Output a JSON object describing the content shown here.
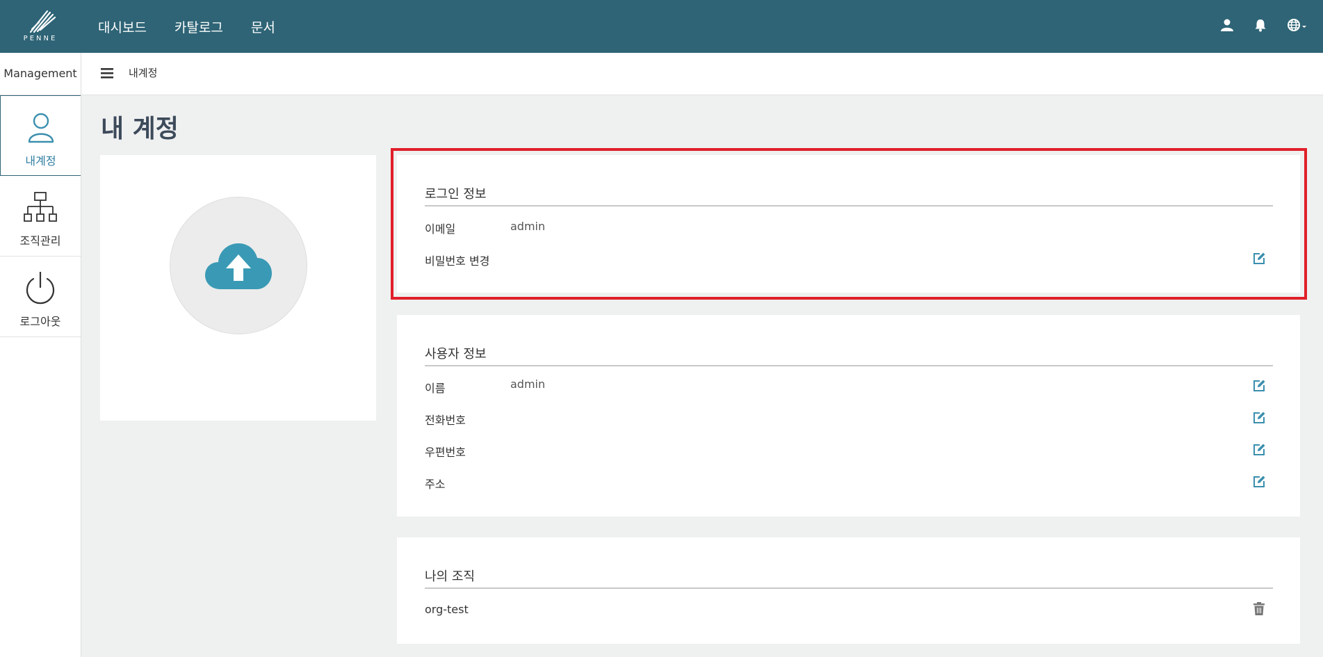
{
  "brand": {
    "logo_text": "PENNE"
  },
  "nav": {
    "items": [
      "대시보드",
      "카탈로그",
      "문서"
    ]
  },
  "header_icons": [
    "user-icon",
    "bell-icon",
    "globe-icon"
  ],
  "sidebar": {
    "header": "Management",
    "items": [
      {
        "label": "내계정",
        "icon": "user-outline-icon",
        "active": true
      },
      {
        "label": "조직관리",
        "icon": "org-chart-icon"
      },
      {
        "label": "로그아웃",
        "icon": "power-icon"
      }
    ]
  },
  "breadcrumb": {
    "current": "내계정"
  },
  "page": {
    "title": "내 계정"
  },
  "avatar": {
    "icon": "cloud-upload-icon"
  },
  "login_info": {
    "title": "로그인 정보",
    "email_label": "이메일",
    "email_value": "admin",
    "password_label": "비밀번호 변경"
  },
  "user_info": {
    "title": "사용자 정보",
    "rows": [
      {
        "label": "이름",
        "value": "admin"
      },
      {
        "label": "전화번호",
        "value": ""
      },
      {
        "label": "우편번호",
        "value": ""
      },
      {
        "label": "주소",
        "value": ""
      }
    ]
  },
  "org": {
    "title": "나의 조직",
    "items": [
      "org-test"
    ]
  },
  "colors": {
    "topbar": "#2e6476",
    "accent": "#3a9ab5",
    "highlight": "#e01f2a"
  }
}
